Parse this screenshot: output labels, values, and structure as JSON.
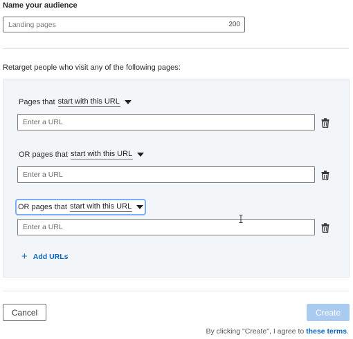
{
  "audience": {
    "label": "Name your audience",
    "placeholder": "Landing pages",
    "char_count": "200"
  },
  "retarget_label": "Retarget people who visit any of the following pages:",
  "rules": [
    {
      "prefix": "Pages that",
      "match": "start with this URL",
      "url_placeholder": "Enter a URL"
    },
    {
      "prefix": "OR pages that",
      "match": "start with this URL",
      "url_placeholder": "Enter a URL"
    },
    {
      "prefix": "OR pages that",
      "match": "start with this URL",
      "url_placeholder": "Enter a URL"
    }
  ],
  "add_urls_label": "Add URLs",
  "footer": {
    "cancel_label": "Cancel",
    "create_label": "Create",
    "terms_text": "By clicking \"Create\", I agree to ",
    "terms_link": "these terms",
    "terms_end": "."
  },
  "icons": {
    "trash": "trash-icon",
    "plus": "plus-icon",
    "caret": "caret-down-icon"
  },
  "colors": {
    "accent": "#0a66c2",
    "create_disabled": "#aacbf0",
    "panel_bg": "#f3f6f8",
    "focus_ring": "#7aaef5"
  }
}
